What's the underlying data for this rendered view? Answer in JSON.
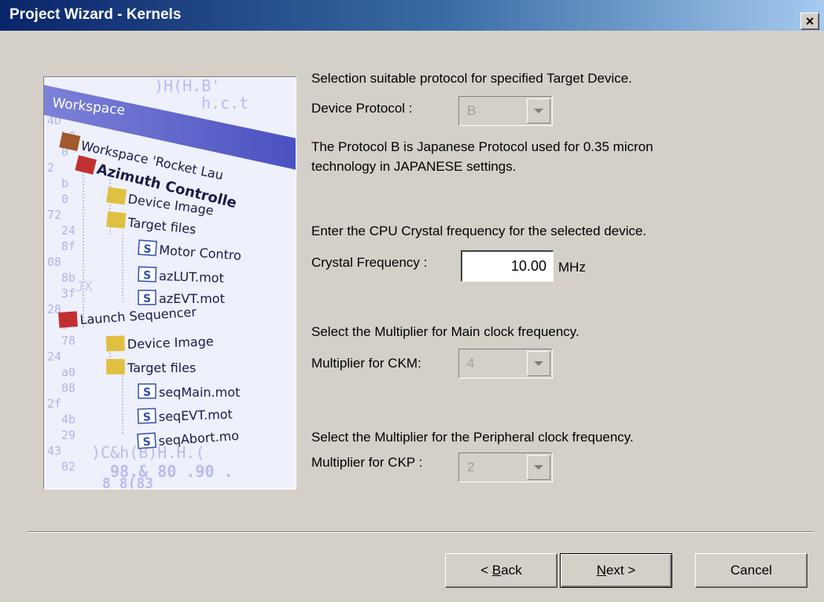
{
  "window": {
    "title": "Project Wizard - Kernels",
    "close_glyph": "×"
  },
  "preview": {
    "workspace_tab": "Workspace",
    "tree": [
      {
        "label": "Workspace 'Rocket Lau",
        "icon": "workspace-icon"
      },
      {
        "label": "Azimuth Controlle",
        "icon": "project-icon"
      },
      {
        "label": "Device Image",
        "icon": "folder-icon"
      },
      {
        "label": "Target files",
        "icon": "folder-icon"
      },
      {
        "label": "Motor Contro",
        "icon": "source-file-icon"
      },
      {
        "label": "azLUT.mot",
        "icon": "source-file-icon"
      },
      {
        "label": "azEVT.mot",
        "icon": "source-file-icon"
      },
      {
        "label": "Launch Sequencer",
        "icon": "project-icon"
      },
      {
        "label": "Device Image",
        "icon": "folder-icon"
      },
      {
        "label": "Target files",
        "icon": "folder-icon"
      },
      {
        "label": "seqMain.mot",
        "icon": "source-file-icon"
      },
      {
        "label": "seqEVT.mot",
        "icon": "source-file-icon"
      },
      {
        "label": "seqAbort.mo",
        "icon": "source-file-icon"
      }
    ],
    "bg_glyphs_top": ")H(H.B'",
    "bg_glyphs_top2": "h.c.t",
    "bg_glyphs_bottom": "98.& 80 .90 .",
    "bg_glyphs_bottom2": "8 8(83",
    "bg_glyphs_bottom3": ")C&h(B)H.H.(",
    "bg_glyphs_mid": "JX",
    "left_col": [
      "4D",
      "b0",
      "0",
      "2",
      "b",
      "0",
      "72",
      "24",
      "8f",
      "08",
      "8b",
      "3f",
      "28",
      "b",
      "78",
      "24",
      "a0",
      "08",
      "2f",
      "4b",
      "29",
      "43",
      "02"
    ],
    "icon_letter": "S"
  },
  "form": {
    "protocol_intro": "Selection suitable protocol for specified Target Device.",
    "protocol_label": "Device Protocol :",
    "protocol_value": "B",
    "protocol_desc_line1": "The Protocol B is Japanese Protocol used for  0.35 micron",
    "protocol_desc_line2": "technology in JAPANESE settings.",
    "crystal_intro": "Enter the CPU Crystal frequency for the selected device.",
    "crystal_label": "Crystal Frequency :",
    "crystal_value": "10.00",
    "crystal_unit": "MHz",
    "ckm_intro": "Select the Multiplier for Main clock frequency.",
    "ckm_label": "Multiplier for CKM:",
    "ckm_value": "4",
    "ckp_intro": "Select the Multiplier for the Peripheral clock frequency.",
    "ckp_label": "Multiplier for CKP :",
    "ckp_value": "2"
  },
  "buttons": {
    "back_prefix": "< ",
    "back_mnemonic": "B",
    "back_rest": "ack",
    "next_mnemonic": "N",
    "next_rest": "ext >",
    "cancel": "Cancel"
  }
}
